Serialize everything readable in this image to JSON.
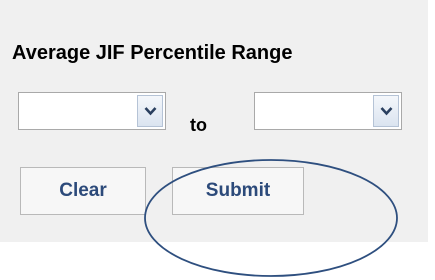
{
  "form": {
    "title": "Average JIF Percentile Range",
    "range_separator": "to",
    "min_select": {
      "value": ""
    },
    "max_select": {
      "value": ""
    },
    "clear_label": "Clear",
    "submit_label": "Submit"
  },
  "colors": {
    "panel_background": "#f0f0f0",
    "button_text": "#2c4a7a",
    "annotation_ellipse": "#2e4f7f"
  },
  "icons": {
    "dropdown_arrow": "chevron-down-icon"
  }
}
